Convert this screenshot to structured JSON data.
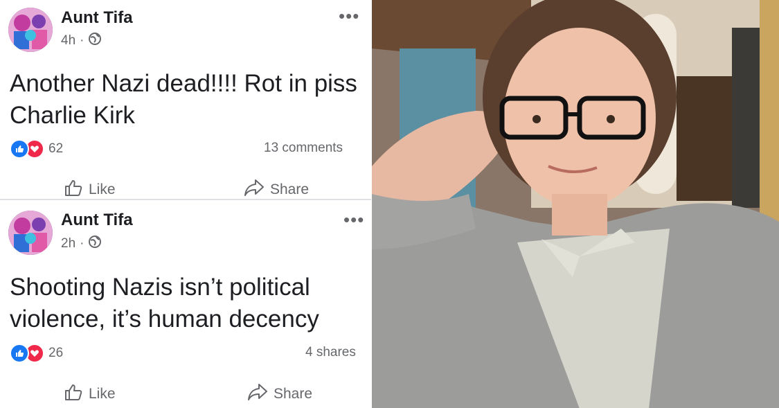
{
  "posts": [
    {
      "author": "Aunt Tifa",
      "time": "4h",
      "separator": "·",
      "text": "Another Nazi dead!!!! Rot in piss Charlie Kirk",
      "reaction_count": "62",
      "stat_right": "13 comments",
      "like_label": "Like",
      "share_label": "Share"
    },
    {
      "author": "Aunt Tifa",
      "time": "2h",
      "separator": "·",
      "text": "Shooting Nazis isn’t political violence, it’s human decency",
      "reaction_count": "26",
      "stat_right": "4 shares",
      "like_label": "Like",
      "share_label": "Share"
    }
  ],
  "more_glyph": "•••",
  "icons": [
    "globe-icon",
    "like-reaction-icon",
    "love-reaction-icon",
    "thumbs-up-icon",
    "share-arrow-icon",
    "more-options-icon"
  ],
  "colors": {
    "text": "#1c1e21",
    "secondary": "#65676b",
    "like_blue": "#1877f2",
    "love_red": "#f02849"
  }
}
